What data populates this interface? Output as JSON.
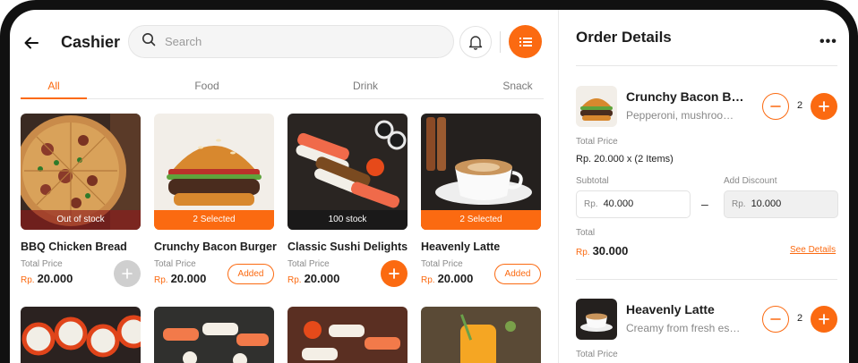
{
  "header": {
    "title": "Cashier",
    "search_placeholder": "Search"
  },
  "tabs": [
    {
      "label": "All"
    },
    {
      "label": "Food"
    },
    {
      "label": "Drink"
    },
    {
      "label": "Snack"
    }
  ],
  "products": [
    {
      "name": "BBQ Chicken Bread",
      "badge": "Out of stock",
      "price_label": "Total Price",
      "currency": "Rp.",
      "price": "20.000",
      "action": "add-disabled",
      "image": "pizza"
    },
    {
      "name": "Crunchy Bacon Burger",
      "badge": "2 Selected",
      "price_label": "Total Price",
      "currency": "Rp.",
      "price": "20.000",
      "action_label": "Added",
      "image": "burger"
    },
    {
      "name": "Classic Sushi Delights",
      "badge": "100 stock",
      "price_label": "Total Price",
      "currency": "Rp.",
      "price": "20.000",
      "action": "add",
      "image": "sushi"
    },
    {
      "name": "Heavenly Latte",
      "badge": "2 Selected",
      "price_label": "Total Price",
      "currency": "Rp.",
      "price": "20.000",
      "action_label": "Added",
      "image": "latte"
    }
  ],
  "order": {
    "title": "Order Details",
    "items": [
      {
        "name": "Crunchy Bacon Burger",
        "description": "Pepperoni, mushrooms, cheese",
        "qty": "2",
        "total_price_label": "Total Price",
        "total_price_value": "Rp. 20.000 x (2 Items)",
        "subtotal_label": "Subtotal",
        "subtotal_currency": "Rp.",
        "subtotal_value": "40.000",
        "discount_label": "Add Discount",
        "discount_currency": "Rp.",
        "discount_value": "10.000",
        "total_label": "Total",
        "total_currency": "Rp.",
        "total_value": "30.000",
        "details_link": "See Details"
      },
      {
        "name": "Heavenly Latte",
        "description": "Creamy from fresh espresso",
        "qty": "2",
        "total_price_label": "Total Price"
      }
    ]
  },
  "colors": {
    "accent": "#fb6a11",
    "text": "#1d1d1d",
    "muted": "#8a8a8a"
  }
}
